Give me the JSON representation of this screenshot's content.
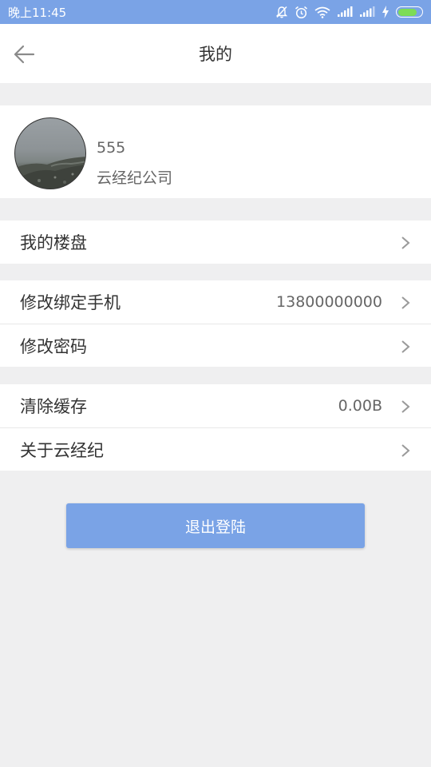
{
  "status_bar": {
    "time": "晚上11:45",
    "icons": [
      "mute-bell-icon",
      "alarm-icon",
      "wifi-icon",
      "signal-icon",
      "signal-icon",
      "charging-icon",
      "battery-icon"
    ],
    "accent_color": "#7aa3e6"
  },
  "header": {
    "title": "我的",
    "back_icon": "back-arrow-icon"
  },
  "profile": {
    "name": "555",
    "company": "云经纪公司"
  },
  "groups": [
    {
      "items": [
        {
          "label": "我的楼盘",
          "value": ""
        }
      ]
    },
    {
      "items": [
        {
          "label": "修改绑定手机",
          "value": "13800000000"
        },
        {
          "label": "修改密码",
          "value": ""
        }
      ]
    },
    {
      "items": [
        {
          "label": "清除缓存",
          "value": "0.00B"
        },
        {
          "label": "关于云经纪",
          "value": ""
        }
      ]
    }
  ],
  "logout_button": {
    "label": "退出登陆",
    "color": "#7aa3e6"
  }
}
